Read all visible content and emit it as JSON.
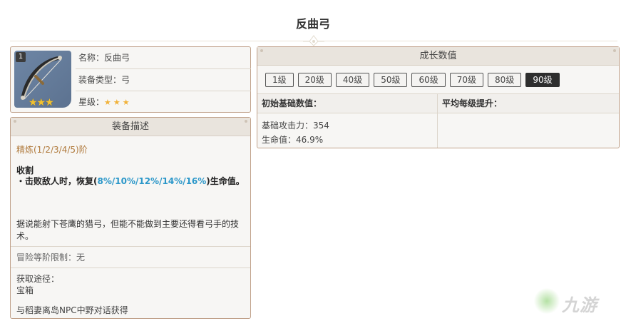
{
  "page": {
    "title": "反曲弓"
  },
  "weapon": {
    "refine_level": "1",
    "stars": "★★★",
    "name_label": "名称：反曲弓",
    "type_label": "装备类型：弓",
    "rarity_label": "星级：",
    "rarity_stars": "★★★"
  },
  "description": {
    "header": "装备描述",
    "refinement": "精炼(1/2/3/4/5)阶",
    "passive_name": "收割",
    "passive_prefix": "・击败敌人时，恢复(",
    "passive_values": "8%/10%/12%/14%/16%",
    "passive_suffix": ")生命值。",
    "lore": "据说能射下苍鹰的猎弓，但能不能做到主要还得看弓手的技术。",
    "ascension": "冒险等阶限制：无",
    "obtain_label": "获取途径：",
    "obtain_source1": "宝箱",
    "obtain_source2": "与稻妻离岛NPC中野对话获得"
  },
  "stats": {
    "header": "成长数值",
    "levels": [
      "1级",
      "20级",
      "40级",
      "50级",
      "60级",
      "70级",
      "80级",
      "90级"
    ],
    "active_level": "90级",
    "base_header": "初始基础数值：",
    "growth_header": "平均每级提升：",
    "base_atk": "基础攻击力：354",
    "base_hp": "生命值：46.9%",
    "growth_values": ""
  },
  "watermark": {
    "text": "九游"
  },
  "colors": {
    "accent_border": "#c0a18a",
    "refine_text": "#b07a3c",
    "highlight": "#2b97c9",
    "star": "#f1b23a"
  }
}
